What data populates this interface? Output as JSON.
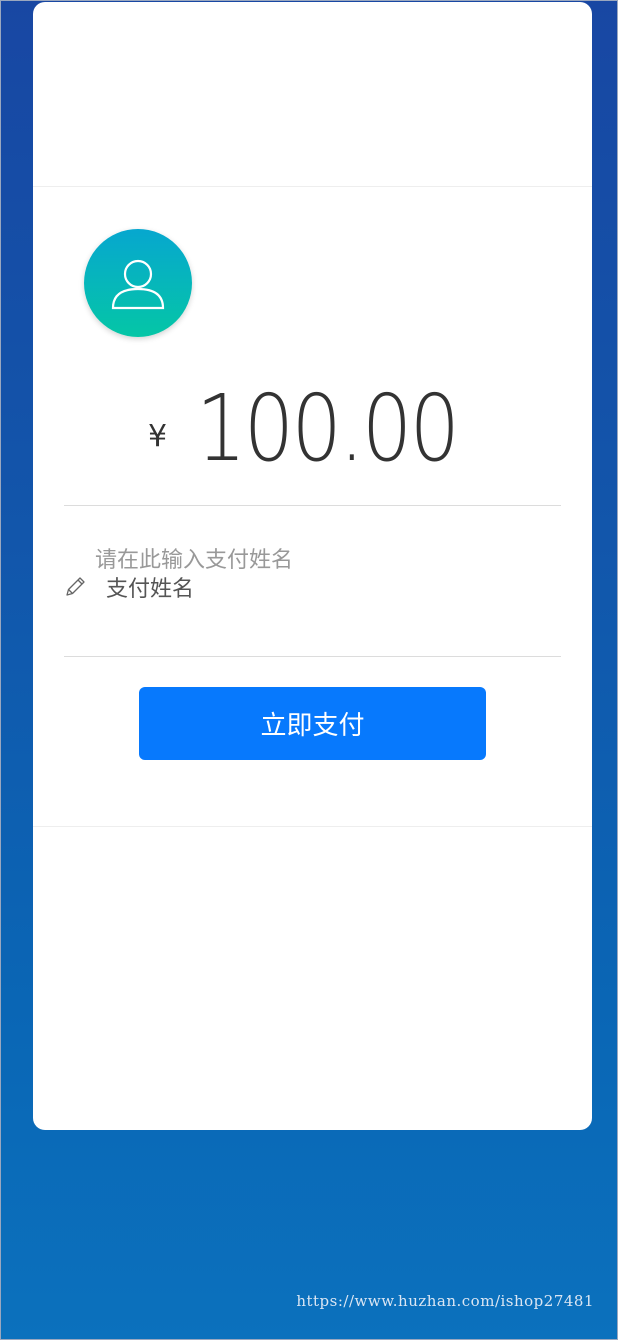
{
  "payment": {
    "currency_symbol": "¥",
    "amount": "100.00"
  },
  "name_field": {
    "hint": "请在此输入支付姓名",
    "placeholder": "支付姓名",
    "value": ""
  },
  "pay_button": {
    "label": "立即支付"
  },
  "watermark": {
    "text": "https://www.huzhan.com/ishop27481"
  },
  "icons": {
    "avatar": "user-icon",
    "edit": "pencil-icon"
  },
  "colors": {
    "background_top": "#1847a3",
    "background_bottom": "#0b71bd",
    "button": "#0779fd",
    "avatar_top": "#06a7cf",
    "avatar_bottom": "#05c6a6"
  }
}
